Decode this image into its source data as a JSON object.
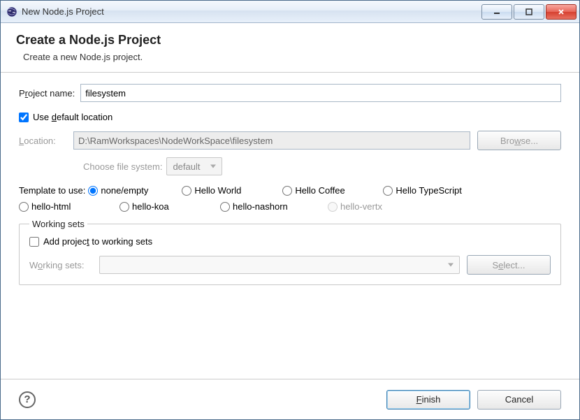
{
  "window": {
    "title": "New Node.js Project"
  },
  "header": {
    "title": "Create a Node.js Project",
    "subtitle": "Create a new Node.js project."
  },
  "project": {
    "name_label_pre": "P",
    "name_label_accel": "r",
    "name_label_post": "oject name:",
    "name_value": "filesystem"
  },
  "location": {
    "use_default_pre": "Use ",
    "use_default_accel": "d",
    "use_default_post": "efault location",
    "use_default_checked": true,
    "label_pre": "",
    "label_accel": "L",
    "label_post": "ocation:",
    "value": "D:\\RamWorkspaces\\NodeWorkSpace\\filesystem",
    "browse_label_pre": "Bro",
    "browse_label_accel": "w",
    "browse_label_post": "se...",
    "choose_fs_label": "Choose file system:",
    "fs_value": "default"
  },
  "template": {
    "label": "Template to use:",
    "options_row1": [
      {
        "value": "none/empty",
        "checked": true,
        "disabled": false
      },
      {
        "value": "Hello World",
        "checked": false,
        "disabled": false
      },
      {
        "value": "Hello Coffee",
        "checked": false,
        "disabled": false
      },
      {
        "value": "Hello TypeScript",
        "checked": false,
        "disabled": false
      }
    ],
    "options_row2": [
      {
        "value": "hello-html",
        "checked": false,
        "disabled": false
      },
      {
        "value": "hello-koa",
        "checked": false,
        "disabled": false
      },
      {
        "value": "hello-nashorn",
        "checked": false,
        "disabled": false
      },
      {
        "value": "hello-vertx",
        "checked": false,
        "disabled": true
      }
    ]
  },
  "working_sets": {
    "legend": "Working sets",
    "add_label_pre": "Add projec",
    "add_label_accel": "t",
    "add_label_post": " to working sets",
    "add_checked": false,
    "ws_label_pre": "W",
    "ws_label_accel": "o",
    "ws_label_post": "rking sets:",
    "select_label_pre": "S",
    "select_label_accel": "e",
    "select_label_post": "lect..."
  },
  "footer": {
    "finish_pre": "",
    "finish_accel": "F",
    "finish_post": "inish",
    "cancel": "Cancel"
  }
}
